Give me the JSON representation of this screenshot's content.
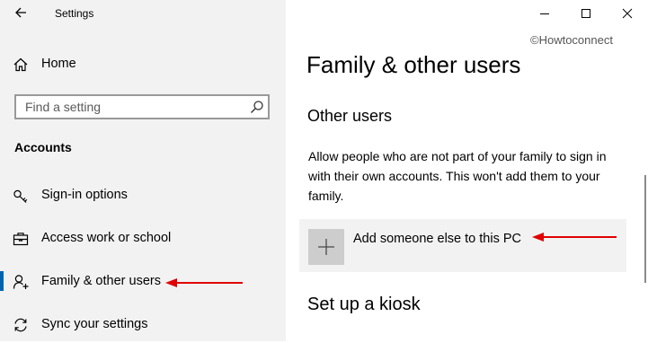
{
  "window": {
    "title": "Settings",
    "watermark": "©Howtoconnect"
  },
  "sidebar": {
    "home_label": "Home",
    "search_placeholder": "Find a setting",
    "section_heading": "Accounts",
    "items": [
      {
        "label": "Sign-in options",
        "icon": "key-icon"
      },
      {
        "label": "Access work or school",
        "icon": "briefcase-icon"
      },
      {
        "label": "Family & other users",
        "icon": "add-person-icon",
        "selected": true
      },
      {
        "label": "Sync your settings",
        "icon": "sync-icon"
      }
    ]
  },
  "main": {
    "page_title": "Family & other users",
    "other_users_heading": "Other users",
    "description": "Allow people who are not part of your family to sign in with their own accounts. This won't add them to your family.",
    "add_user_label": "Add someone else to this PC",
    "kiosk_heading": "Set up a kiosk"
  },
  "colors": {
    "sidebar_bg": "#f2f2f2",
    "accent": "#0063b1",
    "annotation_arrow": "#e00000",
    "card_bg": "#f2f2f2",
    "plus_tile": "#cdcdcd"
  }
}
